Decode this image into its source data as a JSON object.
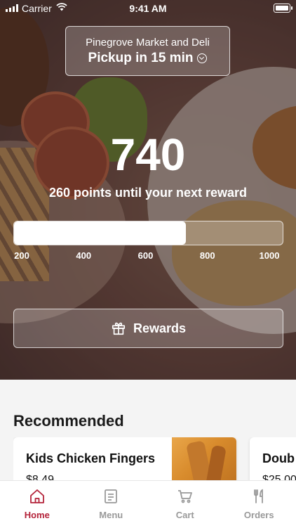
{
  "status_bar": {
    "carrier": "Carrier",
    "time": "9:41 AM"
  },
  "store": {
    "name": "Pinegrove Market and Deli",
    "pickup": "Pickup in 15 min"
  },
  "rewards": {
    "points": "740",
    "subtitle": "260 points until your next reward",
    "progress_fraction": 0.64,
    "ticks": [
      "200",
      "400",
      "600",
      "800",
      "1000"
    ],
    "button_label": "Rewards"
  },
  "recommended": {
    "title": "Recommended",
    "items": [
      {
        "name": "Kids Chicken Fingers",
        "price": "$8.49"
      },
      {
        "name": "Doub",
        "price": "$25.00"
      }
    ]
  },
  "tabs": [
    {
      "label": "Home",
      "icon": "home-icon",
      "active": true
    },
    {
      "label": "Menu",
      "icon": "menu-icon",
      "active": false
    },
    {
      "label": "Cart",
      "icon": "cart-icon",
      "active": false
    },
    {
      "label": "Orders",
      "icon": "utensils-icon",
      "active": false
    }
  ],
  "colors": {
    "accent": "#b4233a",
    "inactive": "#9a9a9a"
  }
}
